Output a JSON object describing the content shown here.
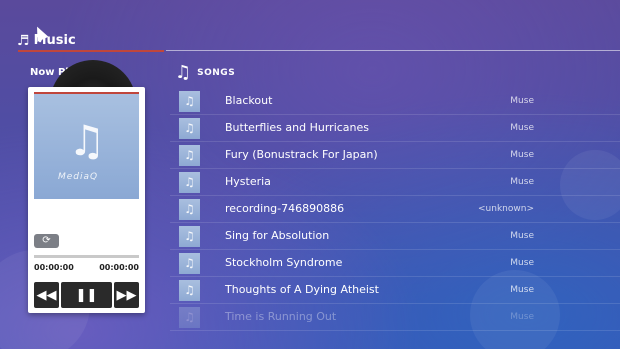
{
  "header": {
    "title": "Music",
    "icon": "music-note-icon"
  },
  "now_playing": {
    "label": "Now Playing",
    "album_brand": "MediaQ",
    "time_elapsed": "00:00:00",
    "time_total": "00:00:00",
    "progress": 0
  },
  "songs": {
    "header": "SONGS",
    "items": [
      {
        "title": "Blackout",
        "artist": "Muse"
      },
      {
        "title": "Butterflies and Hurricanes",
        "artist": "Muse"
      },
      {
        "title": "Fury (Bonustrack For Japan)",
        "artist": "Muse"
      },
      {
        "title": "Hysteria",
        "artist": "Muse"
      },
      {
        "title": "recording-746890886",
        "artist": "<unknown>"
      },
      {
        "title": "Sing for Absolution",
        "artist": "Muse"
      },
      {
        "title": "Stockholm Syndrome",
        "artist": "Muse"
      },
      {
        "title": "Thoughts of A Dying Atheist",
        "artist": "Muse"
      },
      {
        "title": "Time is Running Out",
        "artist": "Muse"
      }
    ]
  },
  "colors": {
    "accent_red": "#c0463c",
    "thumb_blue": "#8ea9d3"
  }
}
